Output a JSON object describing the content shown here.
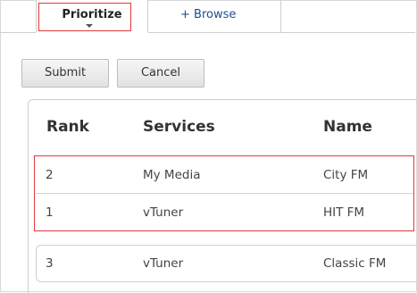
{
  "tabs": {
    "prioritize_label": "Prioritize",
    "browse_label": "+ Browse"
  },
  "buttons": {
    "submit_label": "Submit",
    "cancel_label": "Cancel"
  },
  "table": {
    "headers": {
      "rank": "Rank",
      "services": "Services",
      "name": "Name"
    },
    "rows": [
      {
        "rank": "2",
        "service": "My Media",
        "name": "City FM"
      },
      {
        "rank": "1",
        "service": "vTuner",
        "name": "HIT FM"
      },
      {
        "rank": "3",
        "service": "vTuner",
        "name": "Classic FM"
      }
    ]
  },
  "colors": {
    "highlight": "#e03a3a",
    "link": "#1f4e8c"
  }
}
